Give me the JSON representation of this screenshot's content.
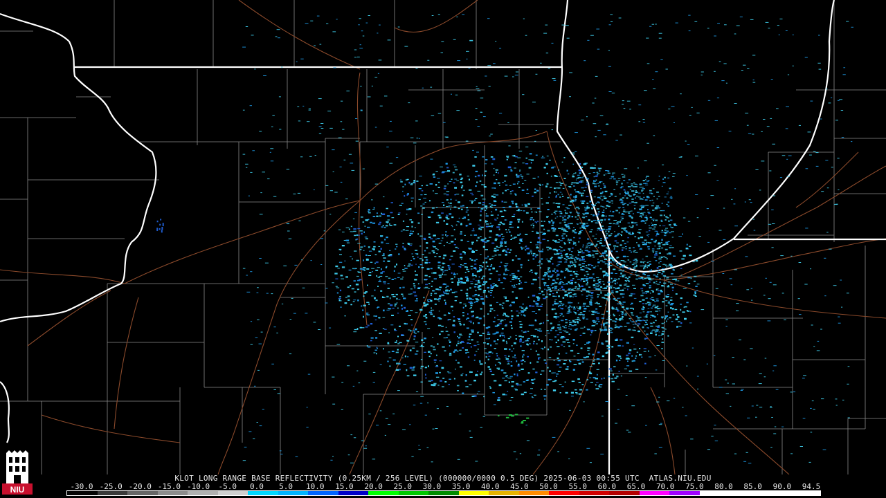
{
  "product": {
    "caption": "KLOT LONG RANGE BASE REFLECTIVITY (0.25KM / 256 LEVEL) (000000/0000 0.5 DEG) 2025-06-03 00:55 UTC  ATLAS.NIU.EDU",
    "logo_text": "NIU"
  },
  "scale": {
    "labels": [
      "-30.0",
      "-25.0",
      "-20.0",
      "-15.0",
      "-10.0",
      "-5.0",
      "0.0",
      "5.0",
      "10.0",
      "15.0",
      "20.0",
      "25.0",
      "30.0",
      "35.0",
      "40.0",
      "45.0",
      "50.0",
      "55.0",
      "60.0",
      "65.0",
      "70.0",
      "75.0",
      "80.0",
      "85.0",
      "90.0",
      "94.5"
    ],
    "colors": [
      "#050505",
      "#3a3a3a",
      "#666666",
      "#8c8c8c",
      "#b0b0b0",
      "#cfcfcf",
      "#00d7ff",
      "#00b4ff",
      "#0064ff",
      "#0000c8",
      "#00ff00",
      "#00c800",
      "#008c00",
      "#ffff00",
      "#e6b400",
      "#ff8c00",
      "#ff0000",
      "#d20000",
      "#b40000",
      "#ff00ff",
      "#a000ff",
      "#ffffff",
      "#ffffff",
      "#ffffff",
      "#ffffff"
    ]
  },
  "map": {
    "colors": {
      "background": "#000000",
      "state_border": "#ffffff",
      "county_border": "#8a8a8a",
      "highway": "#8b4a2b",
      "echo_light": "#3fd0f0",
      "echo_mid": "#1e9be8",
      "echo_dark": "#2060d8",
      "echo_green": "#20c040"
    }
  }
}
